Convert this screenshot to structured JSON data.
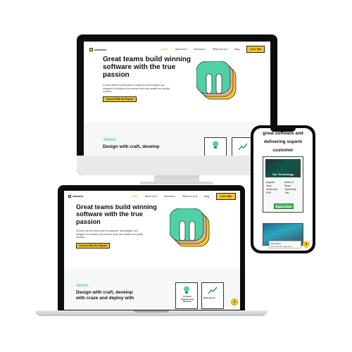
{
  "site": {
    "brand": "inkmarks",
    "nav": [
      {
        "label": "Home",
        "active": true
      },
      {
        "label": "About Us ▾",
        "active": false
      },
      {
        "label": "Services ▾",
        "active": false
      },
      {
        "label": "What we do ▾",
        "active": false
      },
      {
        "label": "Blog",
        "active": false
      }
    ],
    "cta": "Let's Talk",
    "hero_title": "Great teams build winning software with the true passion",
    "hero_desc": "Connect with the dream-team of engineers, technologists, and designers to translate your business vision into scalable and quality solutions.",
    "hero_button": "Connect With Our Experts",
    "section_pill": "What we do",
    "section_title_desktop": "Design with craft, develop",
    "section_title_laptop": "Design with craft, develop with craze and deploy with",
    "card_label": "Product Engineering Services",
    "card_label_2": "Data and AI",
    "chat_icon": "chat-bubble-icon"
  },
  "phone": {
    "heading": "great software and delivering superb customer experiences.",
    "card_title": "Our Technology",
    "technologies": [
      "Angular",
      "Node.Js",
      "Java",
      "React",
      "JavaScript",
      "TypeScript",
      "PHP",
      ".Net"
    ],
    "card_button": "Explore More",
    "chat_title": "Hey there!",
    "chat_text": "How can we help you?"
  },
  "colors": {
    "accent": "#f3c623",
    "pill_bg": "#d7f5ea",
    "green": "#53c262"
  }
}
